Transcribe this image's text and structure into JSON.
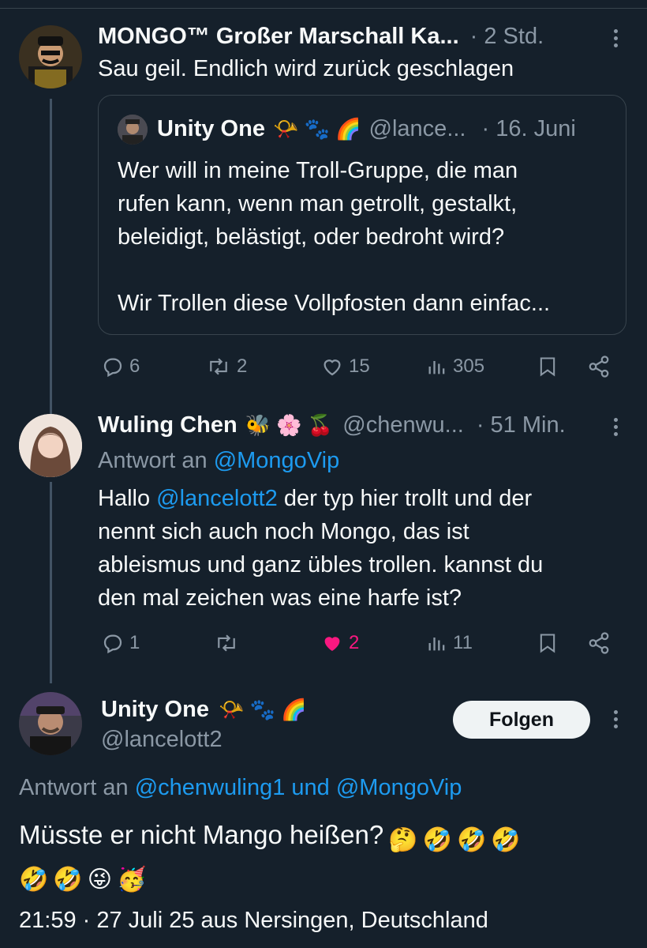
{
  "tweet1": {
    "name": "MONGO™ Großer Marschall Ka...",
    "time": "· 2 Std.",
    "text": "Sau geil. Endlich wird zurück geschlagen",
    "quote": {
      "name": "Unity One",
      "emojis": "📯 🐾 🌈",
      "handle": "@lance...",
      "time": "· 16. Juni",
      "lines": [
        "Wer will in meine Troll-Gruppe, die man",
        "rufen kann, wenn man getrollt, gestalkt,",
        "beleidigt, belästigt, oder bedroht wird?",
        "Wir Trollen diese Vollpfosten dann einfac..."
      ]
    },
    "actions": {
      "replies": "6",
      "reposts": "2",
      "likes": "15",
      "views": "305"
    }
  },
  "tweet2": {
    "name": "Wuling Chen",
    "emojis": "🐝 🌸 🍒",
    "handle": "@chenwu...",
    "time": "· 51 Min.",
    "reply_prefix": "Antwort an",
    "reply_to": "@MongoVip",
    "text_mention": "@lancelott2",
    "text_lines": [
      "Hallo",
      "der typ hier trollt und der",
      "nennt sich auch noch Mongo, das ist",
      "ableismus und ganz übles trollen. kannst du",
      "den mal zeichen was eine harfe ist?"
    ],
    "actions": {
      "replies": "1",
      "likes": "2",
      "views": "11"
    }
  },
  "tweet3": {
    "name": "Unity One",
    "emojis": "📯 🐾 🌈",
    "handle": "@lancelott2",
    "follow_label": "Folgen",
    "reply_prefix": "Antwort an",
    "reply_to": "@chenwuling1 und @MongoVip",
    "text": "Müsste er nicht Mango heißen?",
    "text_emojis": [
      "🤔",
      "🤣",
      "🤣",
      "🤣",
      "🤣",
      "🤣",
      "😜",
      "🥳"
    ],
    "meta": "21:59 · 27 Juli 25 aus Nersingen, Deutschland"
  },
  "colors": {
    "background": "#15202b",
    "accent": "#1d9bf0",
    "like": "#f91880",
    "muted": "#8b98a5"
  }
}
